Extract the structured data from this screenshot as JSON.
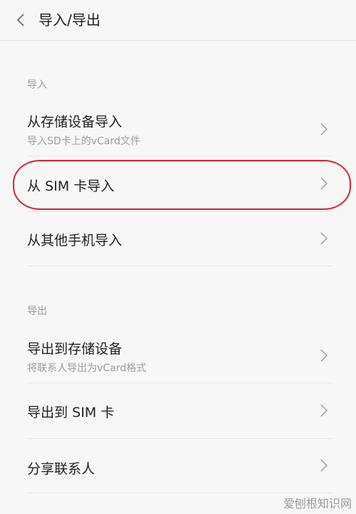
{
  "header": {
    "title": "导入/导出",
    "back_icon": "chevron-left-icon"
  },
  "import_section": {
    "label": "导入",
    "items": [
      {
        "title": "从存储设备导入",
        "subtitle": "导入SD卡上的vCard文件"
      },
      {
        "title": "从 SIM 卡导入"
      },
      {
        "title": "从其他手机导入"
      }
    ]
  },
  "export_section": {
    "label": "导出",
    "items": [
      {
        "title": "导出到存储设备",
        "subtitle": "将联系人导出为vCard格式"
      },
      {
        "title": "导出到 SIM 卡"
      },
      {
        "title": "分享联系人"
      }
    ]
  },
  "annotation": {
    "highlight_color": "#e0203a"
  },
  "watermark": "爱刨根知识网"
}
